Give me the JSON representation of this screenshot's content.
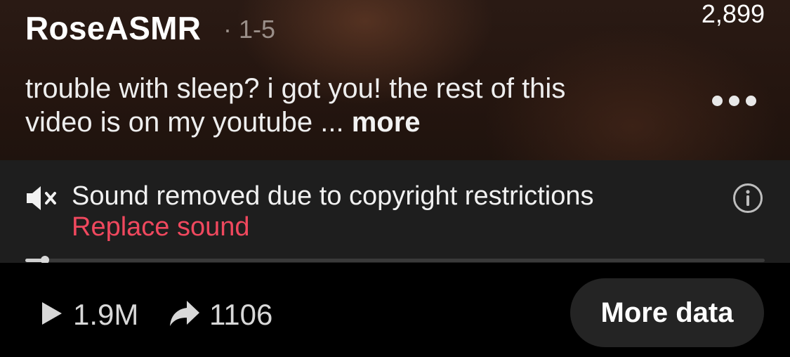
{
  "post": {
    "username": "RoseASMR",
    "date": "· 1-5",
    "top_count": "2,899",
    "caption": "trouble with sleep? i got you! the rest of this video is on my youtube ... ",
    "caption_more": "more"
  },
  "notice": {
    "text": "Sound removed due to copyright restrictions",
    "action": "Replace sound"
  },
  "playback": {
    "progress": 0.027
  },
  "stats": {
    "plays": "1.9M",
    "shares": "1106",
    "more_data_label": "More data"
  },
  "icons": {
    "muted": "speaker-muted-icon",
    "info": "info-icon",
    "menu": "more-options-icon",
    "play": "play-icon",
    "share": "share-arrow-icon"
  },
  "colors": {
    "accent": "#f0485e",
    "background": "#000000",
    "notice_bg": "#1e1e1e",
    "button_bg": "#242424"
  }
}
